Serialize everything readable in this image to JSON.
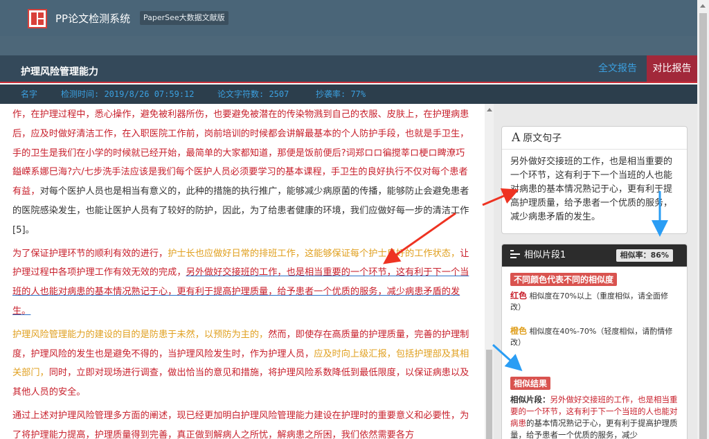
{
  "header": {
    "app_title": "PP论文检测系统",
    "edition": "PaperSee大数据文献版"
  },
  "doc": {
    "title": "护理风险管理能力",
    "tabs": {
      "full_report": "全文报告",
      "compare_report": "对比报告"
    }
  },
  "meta": {
    "name_label": "名字",
    "check_time": "检测时间: 2019/8/26 07:59:12",
    "char_count": "论文字符数: 2507",
    "copy_rate": "抄袭率: 77%"
  },
  "content": {
    "p1": {
      "a": "作，在护理过程中，悉心操作，避免被利器所伤，也要避免被潜在的传染物溅到自己的衣服、皮肤上，在护理病患后，应及时做好清洁工作，在入职医院工作前，岗前培训的时候都会讲解最基本的个人防护手段，也就是手卫生，手的卫生是我们在小学的时候就已经开始，最简单的大家都知道，那便是饭前便后?词郑ロロ徧搅莘ロ梗ロ睥潦巧鎰嵘系娜巳海?六/七步洗手法应该是我们每个医护人员必须要学习的基本课程，手卫生的良好执行不仅对每个患者有益，",
      "b": "对每个医护人员也是相当有意义的，此种的措施的执行推广，能够减少病原菌的传播，能够防止会避免患者的医院感染发生，也能让医护人员有了较好的防护，因此，为了给患者健康的环境，我们应做好每一步的清洁工作[5]。"
    },
    "p2": {
      "a": "为了保证护理环节的顺利有效的进行，",
      "b": "护士长也应做好日常的排班工作，这能够保证每个护士良好的工作状态，",
      "c": "让护理过程中各项护理工作有效无效的完成，",
      "d": "另外做好交接班的工作，也是相当重要的一个环节，这有利于下一个当班的人也能对病患的基本情况熟记于心，更有利于提高护理质量，给予患者一个优质的服务，减少病患矛盾的发生。"
    },
    "p3": {
      "a": "护理风险管理能力的建设的目的是防患于未然，以预防为主的，",
      "b": "然而，即使存在高质量的护理质量，完善的护理制度，护理风险的发生也是避免不得的，当护理风险发生时，作为护理人员，",
      "c": "应及时向上级汇报，包括护理部及其相关部门，",
      "d": "同时，立即对现场进行调查，做出恰当的意见和措施，将护理风险系数降低到最低限度，以保证病患以及其他人员的安全。"
    },
    "p4": {
      "a": "通过上述对护理风险管理多方面的阐述，现已经更加明白护理风险管理能力建设在护理时的重要意义和必要性，为了将护理能力提高，护理质量得到完善，真正做到解病人之所忧，解病患之所困，我们依然需要各方"
    }
  },
  "original_sentence": {
    "title": "原文句子",
    "icon": "A",
    "text": "另外做好交接班的工作，也是相当重要的一个环节，这有利于下一个当班的人也能对病患的基本情况熟记于心，更有利于提高护理质量，给予患者一个优质的服务，减少病患矛盾的发生。"
  },
  "similar": {
    "title": "相似片段1",
    "rate": "相似率：86%",
    "legend_tag": "不同颜色代表不同的相似度",
    "red_key": "红色",
    "red_desc": "相似度在70%以上（重度相似，请全面修改）",
    "orange_key": "橙色",
    "orange_desc": "相似度在40%-70%（轻度相似，请酌情修改）",
    "result_tag": "相似结果",
    "result_label": "相似片段：",
    "result_red": "另外做好交接班的工作，也是相当重要的一个环节，这有利于下一个当班的人也能对病患",
    "result_black": "的基本情况熟记于心，更有利于提高护理质量，给予患者一个优质的服务，减少"
  },
  "colors": {
    "topbar": "#4a6578",
    "header": "#34495a",
    "meta_text": "#3ba0e0",
    "accent_red": "#c8202c",
    "orange": "#e0a020",
    "compare_tab": "#a2283a",
    "annotation_red": "#ee3322",
    "annotation_blue": "#2a9df4"
  }
}
